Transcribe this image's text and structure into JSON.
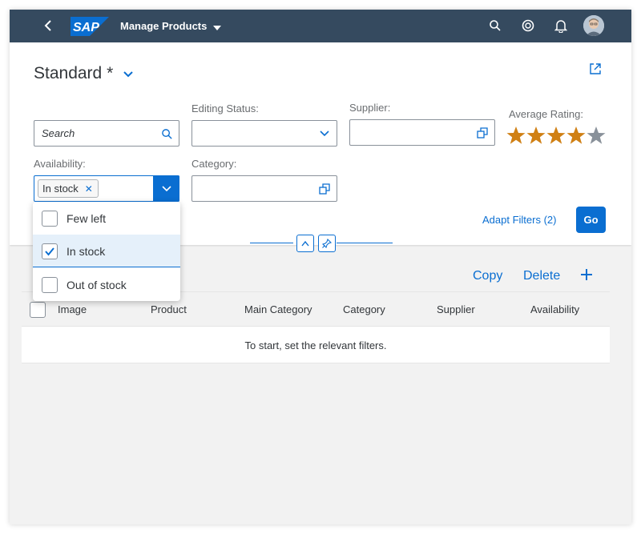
{
  "shell": {
    "app_title": "Manage Products",
    "logo_text": "SAP",
    "colors": {
      "bar": "#354a5f",
      "logo": "#0a6ed1"
    }
  },
  "header": {
    "variant_title": "Standard *"
  },
  "filters": {
    "search": {
      "placeholder": "Search"
    },
    "editing_status": {
      "label": "Editing Status:",
      "value": ""
    },
    "supplier": {
      "label": "Supplier:",
      "value": ""
    },
    "average_rating": {
      "label": "Average Rating:",
      "rating": 4,
      "max": 5,
      "colors": {
        "filled": "#d08014",
        "empty": "#89919a"
      }
    },
    "availability": {
      "label": "Availability:",
      "token": "In stock"
    },
    "category": {
      "label": "Category:",
      "value": ""
    }
  },
  "actions": {
    "adapt_filters": "Adapt Filters (2)",
    "go": "Go"
  },
  "availability_options": [
    {
      "label": "Few left",
      "checked": false
    },
    {
      "label": "In stock",
      "checked": true
    },
    {
      "label": "Out of stock",
      "checked": false
    }
  ],
  "toolbar": {
    "copy": "Copy",
    "delete": "Delete"
  },
  "table": {
    "columns": [
      "Image",
      "Product",
      "Main Category",
      "Category",
      "Supplier",
      "Availability"
    ],
    "no_data": "To start, set the relevant filters."
  },
  "accent": "#0a6ed1"
}
